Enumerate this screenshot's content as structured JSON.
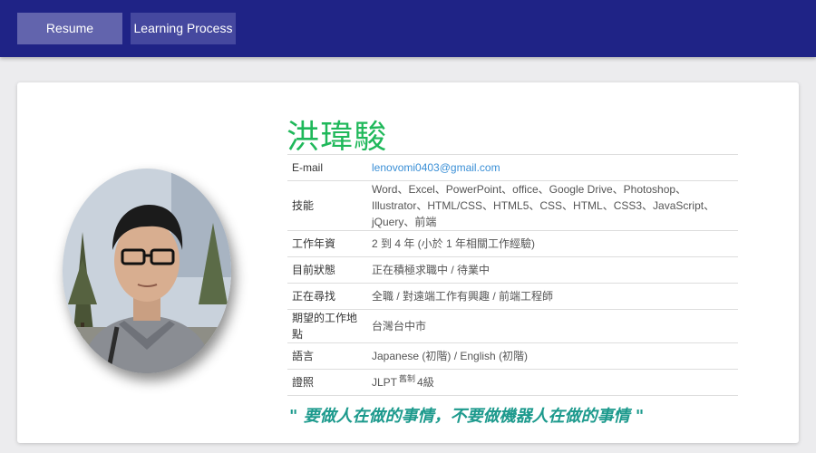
{
  "nav": {
    "resume": "Resume",
    "learning": "Learning Process"
  },
  "profile": {
    "name": "洪瑋駿",
    "photo_icon": "profile-photo",
    "motto": "\" 要做人在做的事情，不要做機器人在做的事情 \""
  },
  "info": {
    "email": {
      "label": "E-mail",
      "value": "lenovomi0403@gmail.com"
    },
    "skills": {
      "label": "技能",
      "value": "Word、Excel、PowerPoint、office、Google Drive、Photoshop、Illustrator、HTML/CSS、HTML5、CSS、HTML、CSS3、JavaScript、jQuery、前端"
    },
    "experience": {
      "label": "工作年資",
      "value": "2 到 4 年 (小於 1 年相關工作經驗)"
    },
    "status": {
      "label": "目前狀態",
      "value": "正在積極求職中 / 待業中"
    },
    "seeking": {
      "label": "正在尋找",
      "value": "全職 / 對遠端工作有興趣 / 前端工程師"
    },
    "location": {
      "label": "期望的工作地點",
      "value": "台灣台中市"
    },
    "language": {
      "label": "語言",
      "value": "Japanese (初階) / English (初階)"
    },
    "license": {
      "label": "證照",
      "value_prefix": "JLPT",
      "value_sup": "舊制",
      "value_suffix": "4級"
    }
  },
  "colors": {
    "topbar": "#1f2386",
    "nav_active": "#6264ad",
    "nav_inactive": "#45489f",
    "name": "#1fb85a",
    "link": "#3a8fd6",
    "motto": "#1d9a8d"
  }
}
